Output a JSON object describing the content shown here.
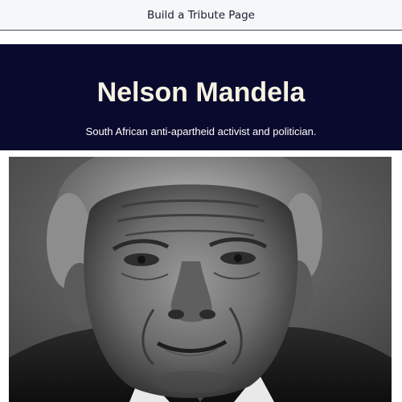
{
  "browser_tab": {
    "title": "Build a Tribute Page"
  },
  "tribute": {
    "heading": "Nelson Mandela",
    "subheading": "South African anti-apartheid activist and politician."
  },
  "image": {
    "subject": "portrait-photo",
    "style": "black-and-white"
  }
}
